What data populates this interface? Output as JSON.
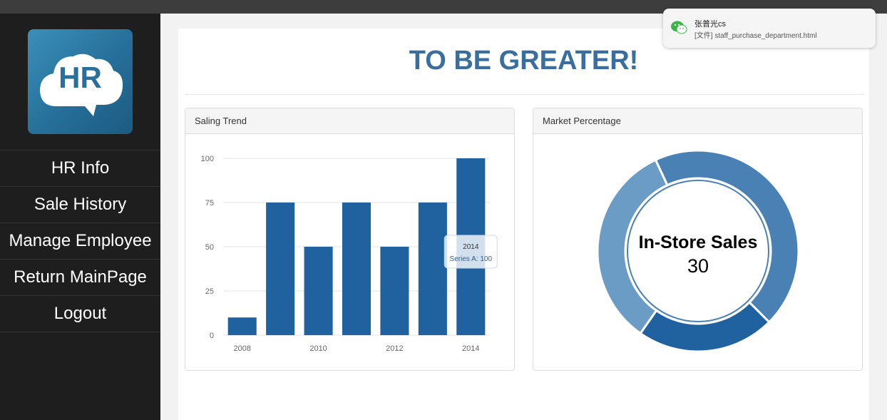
{
  "app": {
    "logo_text": "HR",
    "page_title": "TO BE GREATER!"
  },
  "sidebar": {
    "items": [
      {
        "label": "HR Info"
      },
      {
        "label": "Sale History"
      },
      {
        "label": "Manage Employee"
      },
      {
        "label": "Return MainPage"
      },
      {
        "label": "Logout"
      }
    ]
  },
  "panels": {
    "trend_title": "Saling Trend",
    "market_title": "Market Percentage"
  },
  "notification": {
    "sender": "张普光cs",
    "message": "[文件] staff_purchase_department.html",
    "icon": "wechat-icon"
  },
  "colors": {
    "accent": "#3a6e9e",
    "bar": "#2062a0",
    "sidebar": "#1e1e1e"
  },
  "chart_data": [
    {
      "type": "bar",
      "title": "Saling Trend",
      "categories": [
        "2008",
        "2009",
        "2010",
        "2011",
        "2012",
        "2013",
        "2014"
      ],
      "x_tick_labels": [
        "2008",
        "2010",
        "2012",
        "2014"
      ],
      "series": [
        {
          "name": "Series A",
          "values": [
            10,
            75,
            50,
            75,
            50,
            75,
            100
          ]
        }
      ],
      "ylim": [
        0,
        100
      ],
      "yticks": [
        0,
        25,
        50,
        75,
        100
      ],
      "grid": true,
      "tooltip": {
        "title": "2014",
        "text": "Series A: 100"
      }
    },
    {
      "type": "pie",
      "title": "Market Percentage",
      "donut": true,
      "center_label": "In-Store Sales",
      "center_value": "30",
      "slices": [
        {
          "value": 40,
          "color": "#4a81b4"
        },
        {
          "value": 20,
          "color": "#2062a0"
        },
        {
          "value": 30,
          "color": "#6a9cc5"
        }
      ]
    }
  ]
}
